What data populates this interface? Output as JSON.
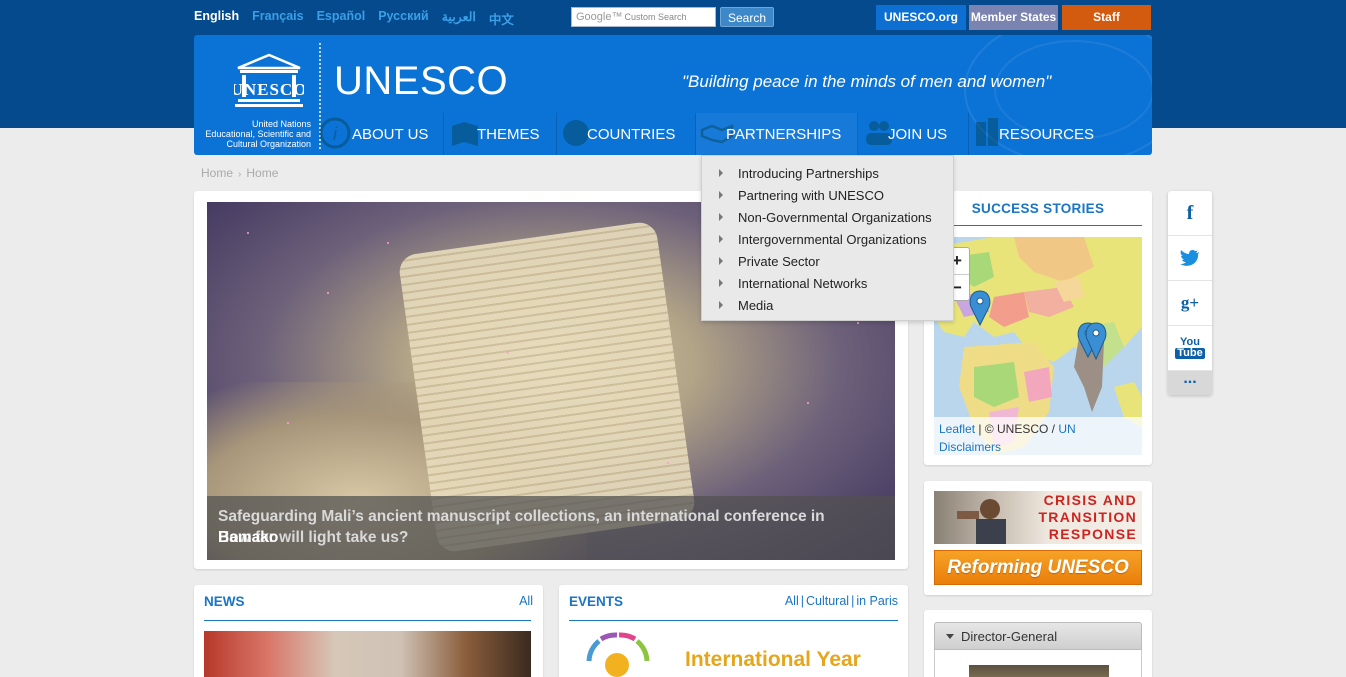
{
  "languages": [
    "English",
    "Français",
    "Español",
    "Русский",
    "العربية",
    "中文"
  ],
  "active_language": "English",
  "search": {
    "brand": "Google™",
    "placeholder": "Custom Search",
    "button_label": "Search"
  },
  "top_links": {
    "unesco_org": "UNESCO.org",
    "member_states": "Member States",
    "staff": "Staff"
  },
  "header": {
    "org_line1": "United Nations",
    "org_line2": "Educational, Scientific and",
    "org_line3": "Cultural Organization",
    "brand": "UNESCO",
    "motto": "\"Building peace in the minds of men and women\""
  },
  "nav": [
    {
      "label": "ABOUT US",
      "icon": "info-icon"
    },
    {
      "label": "THEMES",
      "icon": "book-icon"
    },
    {
      "label": "COUNTRIES",
      "icon": "globe-icon"
    },
    {
      "label": "PARTNERSHIPS",
      "icon": "handshake-icon"
    },
    {
      "label": "JOIN US",
      "icon": "people-icon"
    },
    {
      "label": "RESOURCES",
      "icon": "books-icon"
    }
  ],
  "partnerships_menu": [
    "Introducing Partnerships",
    "Partnering with UNESCO",
    "Non-Governmental Organizations",
    "Intergovernmental Organizations",
    "Private Sector",
    "International Networks",
    "Media"
  ],
  "breadcrumb": [
    "Home",
    "Home"
  ],
  "hero": {
    "caption_line1": "Safeguarding Mali’s ancient manuscript collections, an international conference in",
    "caption_line2_under": "How far will light take us?",
    "caption_line2_over": "Bamako"
  },
  "success_stories": {
    "title": "SUCCESS STORIES",
    "zoom_in": "+",
    "zoom_out": "−",
    "attrib_leaflet": "Leaflet",
    "attrib_sep": " | © UNESCO / ",
    "attrib_un": "UN",
    "attrib_disclaimers": "Disclaimers"
  },
  "social": {
    "facebook": "f",
    "twitter": "t",
    "googleplus": "g+",
    "youtube_1": "You",
    "youtube_2": "Tube",
    "more": "..."
  },
  "crisis": {
    "line1": "CRISIS AND",
    "line2": "TRANSITION",
    "line3": "RESPONSE",
    "reform_label": "Reforming UNESCO"
  },
  "director_general": {
    "label": "Director-General"
  },
  "news": {
    "title": "NEWS",
    "link_all": "All"
  },
  "events": {
    "title": "EVENTS",
    "link_all": "All",
    "link_cultural": "Cultural",
    "link_paris": "in Paris",
    "image_text": "International Year"
  },
  "colors": {
    "dark_blue": "#054a8c",
    "header_blue": "#0c73d6",
    "accent_blue": "#1a75c4",
    "staff_orange": "#d25b10",
    "member_purple": "#7b83b0"
  }
}
